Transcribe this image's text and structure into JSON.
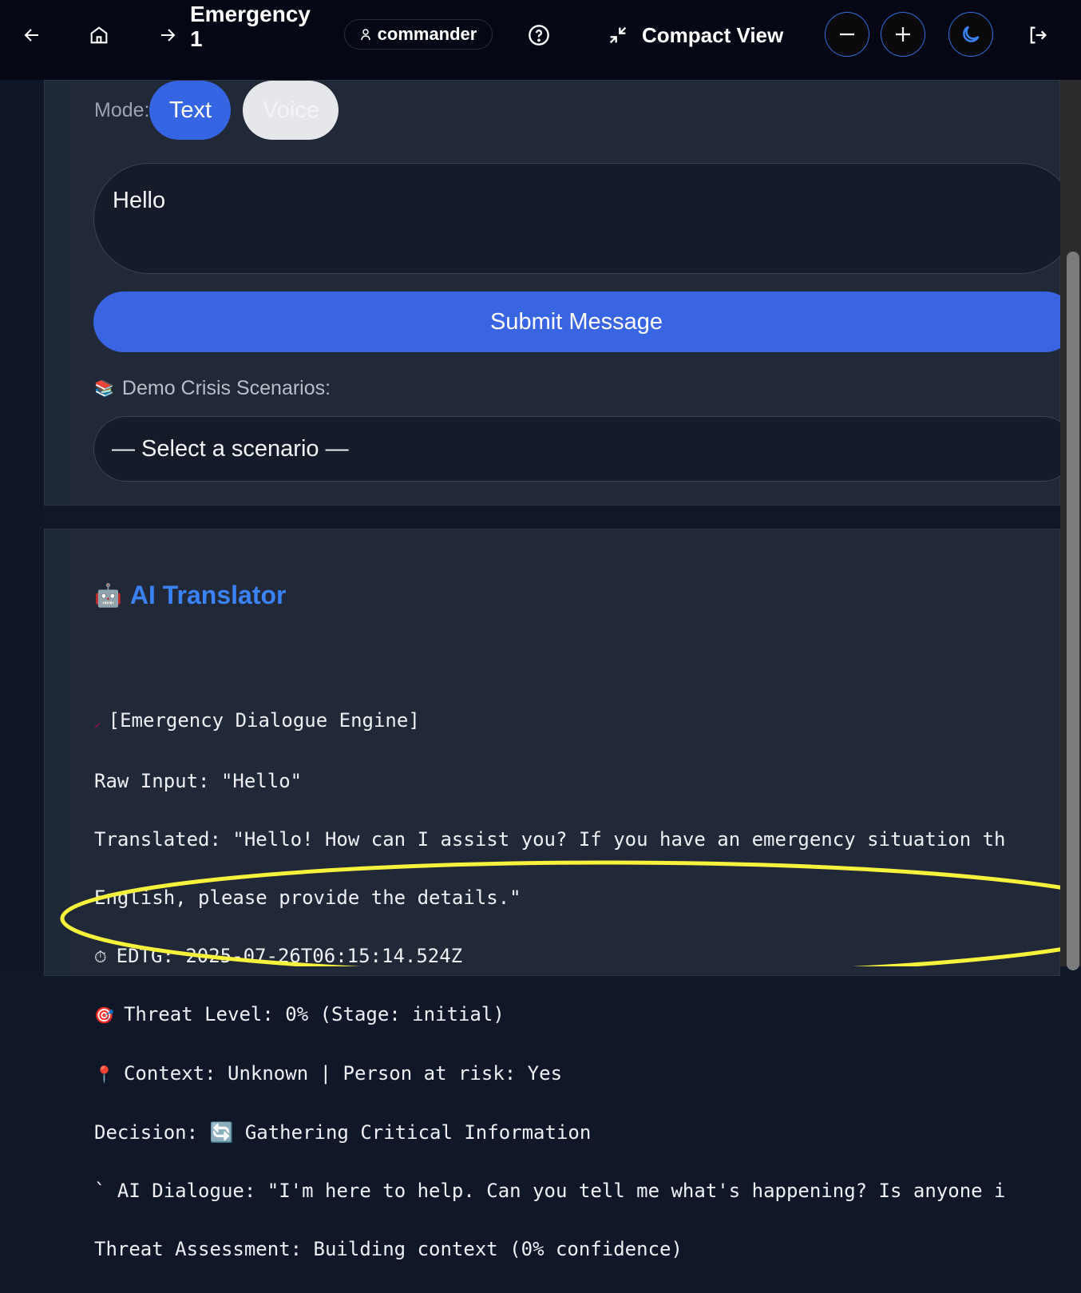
{
  "header": {
    "title": "Emergency 1",
    "user": "commander",
    "compact_label": "Compact View",
    "icons": [
      "arrow-left-icon",
      "home-icon",
      "arrow-right-icon",
      "user-icon",
      "help-icon",
      "minimize-icon",
      "zoom-out-icon",
      "zoom-in-icon",
      "moon-icon",
      "logout-icon"
    ]
  },
  "input": {
    "mode_label": "Mode:",
    "mode_text": "Text",
    "mode_voice": "Voice",
    "message": "Hello",
    "submit": "Submit Message",
    "demo_label": "Demo Crisis Scenarios:",
    "scenario_selected": "— Select a scenario —"
  },
  "translator": {
    "title": "AI Translator",
    "lines": [
      "[Emergency Dialogue Engine]",
      "Raw Input: \"Hello\"",
      "Translated: \"Hello! How can I assist you? If you have an emergency situation th",
      "English, please provide the details.\"",
      "EDTG: 2025-07-26T06:15:14.524Z",
      "Threat Level: 0% (Stage: initial)",
      "Context: Unknown | Person at risk: Yes",
      "Decision: 🔄 Gathering Critical Information",
      "AI Dialogue: \"I'm here to help. Can you tell me what's happening? Is anyone i",
      "Threat Assessment: Building context (0% confidence)"
    ]
  },
  "colors": {
    "accent": "#3a65e2",
    "header_bg": "#050814",
    "card_bg": "#212938",
    "annotation": "#f7f33c"
  }
}
